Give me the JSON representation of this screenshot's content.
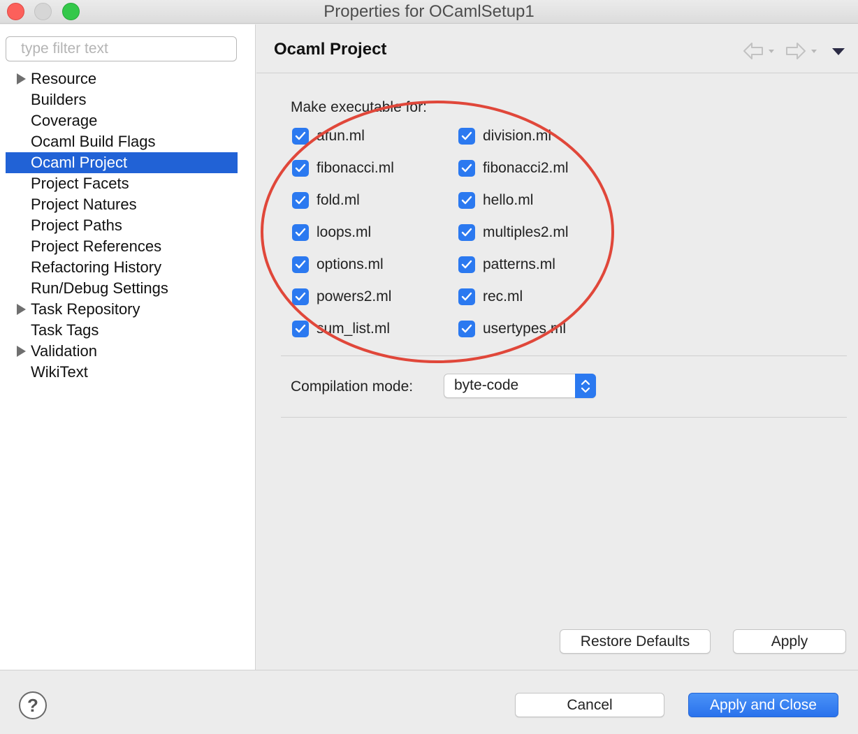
{
  "window": {
    "title": "Properties for OCamlSetup1"
  },
  "sidebar": {
    "filter_placeholder": "type filter text",
    "items": [
      {
        "label": "Resource",
        "expandable": true
      },
      {
        "label": "Builders"
      },
      {
        "label": "Coverage"
      },
      {
        "label": "Ocaml Build Flags"
      },
      {
        "label": "Ocaml Project",
        "selected": true
      },
      {
        "label": "Project Facets"
      },
      {
        "label": "Project Natures"
      },
      {
        "label": "Project Paths"
      },
      {
        "label": "Project References"
      },
      {
        "label": "Refactoring History"
      },
      {
        "label": "Run/Debug Settings"
      },
      {
        "label": "Task Repository",
        "expandable": true
      },
      {
        "label": "Task Tags"
      },
      {
        "label": "Validation",
        "expandable": true
      },
      {
        "label": "WikiText"
      }
    ]
  },
  "main": {
    "title": "Ocaml Project",
    "make_executable_label": "Make executable for:",
    "files": [
      {
        "name": "afun.ml",
        "checked": true
      },
      {
        "name": "division.ml",
        "checked": true
      },
      {
        "name": "fibonacci.ml",
        "checked": true
      },
      {
        "name": "fibonacci2.ml",
        "checked": true
      },
      {
        "name": "fold.ml",
        "checked": true
      },
      {
        "name": "hello.ml",
        "checked": true
      },
      {
        "name": "loops.ml",
        "checked": true
      },
      {
        "name": "multiples2.ml",
        "checked": true
      },
      {
        "name": "options.ml",
        "checked": true
      },
      {
        "name": "patterns.ml",
        "checked": true
      },
      {
        "name": "powers2.ml",
        "checked": true
      },
      {
        "name": "rec.ml",
        "checked": true
      },
      {
        "name": "sum_list.ml",
        "checked": true
      },
      {
        "name": "usertypes.ml",
        "checked": true
      }
    ],
    "compilation_mode_label": "Compilation mode:",
    "compilation_mode_value": "byte-code",
    "restore_defaults_label": "Restore Defaults",
    "apply_label": "Apply"
  },
  "footer": {
    "help_symbol": "?",
    "cancel_label": "Cancel",
    "apply_close_label": "Apply and Close"
  },
  "colors": {
    "accent": "#2b79f0",
    "selection": "#2162d6",
    "annotation_circle": "#e0473a",
    "close_button": "#fc605b",
    "maximize_button": "#34c84a"
  },
  "icons": [
    "back-arrow-icon",
    "forward-arrow-icon",
    "view-menu-icon",
    "checkmark-icon",
    "up-down-stepper-icon",
    "help-icon"
  ]
}
